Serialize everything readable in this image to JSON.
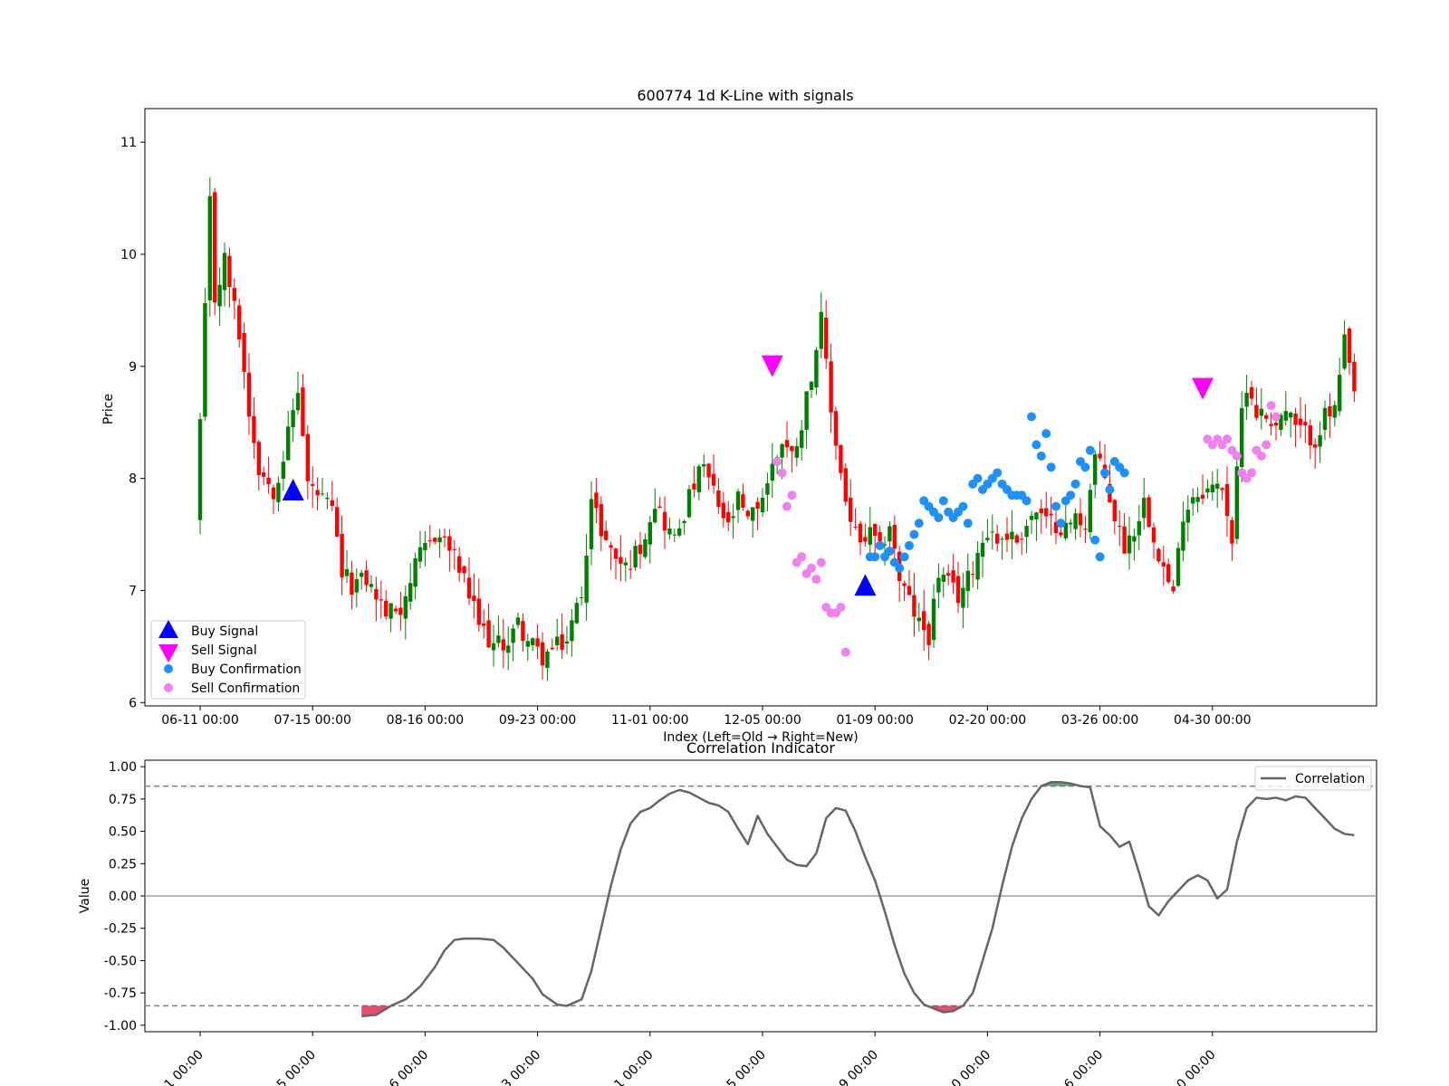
{
  "chart_data": [
    {
      "type": "candlestick",
      "title": "600774 1d K-Line with signals",
      "xlabel": "Index (Left=Old → Right=New)",
      "ylabel": "Price",
      "ylim": [
        5.97,
        11.3
      ],
      "yticks": [
        6,
        7,
        8,
        9,
        10,
        11
      ],
      "xticks": [
        {
          "index": 0,
          "label": "06-11 00:00"
        },
        {
          "index": 23,
          "label": "07-15 00:00"
        },
        {
          "index": 46,
          "label": "08-16 00:00"
        },
        {
          "index": 69,
          "label": "09-23 00:00"
        },
        {
          "index": 92,
          "label": "11-01 00:00"
        },
        {
          "index": 115,
          "label": "12-05 00:00"
        },
        {
          "index": 138,
          "label": "01-09 00:00"
        },
        {
          "index": 161,
          "label": "02-20 00:00"
        },
        {
          "index": 184,
          "label": "03-26 00:00"
        },
        {
          "index": 207,
          "label": "04-30 00:00"
        }
      ],
      "up_color": "#008000",
      "down_color": "#ff0000",
      "close_path": [
        [
          0,
          8.5
        ],
        [
          2,
          10.45
        ],
        [
          3,
          9.6
        ],
        [
          5,
          9.95
        ],
        [
          8,
          9.3
        ],
        [
          10,
          8.6
        ],
        [
          12,
          8.1
        ],
        [
          15,
          7.9
        ],
        [
          17,
          8.2
        ],
        [
          20,
          8.8
        ],
        [
          22,
          7.95
        ],
        [
          25,
          7.8
        ],
        [
          27,
          7.7
        ],
        [
          29,
          7.15
        ],
        [
          31,
          7.05
        ],
        [
          34,
          7.1
        ],
        [
          36,
          6.95
        ],
        [
          38,
          6.8
        ],
        [
          41,
          6.85
        ],
        [
          43,
          7.1
        ],
        [
          45,
          7.3
        ],
        [
          48,
          7.5
        ],
        [
          50,
          7.45
        ],
        [
          53,
          7.2
        ],
        [
          55,
          6.95
        ],
        [
          57,
          6.7
        ],
        [
          60,
          6.5
        ],
        [
          63,
          6.55
        ],
        [
          65,
          6.7
        ],
        [
          67,
          6.55
        ],
        [
          70,
          6.4
        ],
        [
          73,
          6.5
        ],
        [
          75,
          6.55
        ],
        [
          78,
          7.0
        ],
        [
          80,
          7.8
        ],
        [
          82,
          7.55
        ],
        [
          84,
          7.35
        ],
        [
          87,
          7.2
        ],
        [
          90,
          7.4
        ],
        [
          93,
          7.8
        ],
        [
          95,
          7.6
        ],
        [
          97,
          7.45
        ],
        [
          99,
          7.7
        ],
        [
          101,
          7.95
        ],
        [
          103,
          8.1
        ],
        [
          106,
          7.75
        ],
        [
          108,
          7.55
        ],
        [
          110,
          7.8
        ],
        [
          112,
          7.6
        ],
        [
          115,
          7.85
        ],
        [
          117,
          8.1
        ],
        [
          119,
          8.35
        ],
        [
          121,
          8.2
        ],
        [
          123,
          8.5
        ],
        [
          125,
          8.95
        ],
        [
          127,
          9.4
        ],
        [
          129,
          8.6
        ],
        [
          131,
          8.05
        ],
        [
          133,
          7.6
        ],
        [
          135,
          7.4
        ],
        [
          137,
          7.5
        ],
        [
          139,
          7.35
        ],
        [
          141,
          7.6
        ],
        [
          143,
          7.1
        ],
        [
          145,
          6.9
        ],
        [
          147,
          6.7
        ],
        [
          149,
          6.6
        ],
        [
          151,
          7.15
        ],
        [
          153,
          7.05
        ],
        [
          155,
          6.95
        ],
        [
          157,
          7.1
        ],
        [
          159,
          7.35
        ],
        [
          161,
          7.55
        ],
        [
          163,
          7.45
        ],
        [
          165,
          7.5
        ],
        [
          167,
          7.45
        ],
        [
          169,
          7.6
        ],
        [
          171,
          7.7
        ],
        [
          173,
          7.6
        ],
        [
          175,
          7.6
        ],
        [
          177,
          7.55
        ],
        [
          179,
          7.65
        ],
        [
          181,
          7.6
        ],
        [
          183,
          8.2
        ],
        [
          185,
          8.0
        ],
        [
          187,
          7.65
        ],
        [
          189,
          7.4
        ],
        [
          191,
          7.55
        ],
        [
          193,
          7.8
        ],
        [
          195,
          7.5
        ],
        [
          197,
          7.2
        ],
        [
          199,
          6.95
        ],
        [
          201,
          7.7
        ],
        [
          203,
          7.85
        ],
        [
          205,
          7.9
        ],
        [
          207,
          7.9
        ],
        [
          209,
          7.95
        ],
        [
          211,
          7.45
        ],
        [
          213,
          8.6
        ],
        [
          214,
          8.85
        ],
        [
          216,
          8.6
        ],
        [
          218,
          8.55
        ],
        [
          220,
          8.5
        ],
        [
          222,
          8.6
        ],
        [
          224,
          8.45
        ],
        [
          226,
          8.4
        ],
        [
          228,
          8.35
        ],
        [
          230,
          8.55
        ],
        [
          232,
          8.6
        ],
        [
          234,
          9.2
        ],
        [
          236,
          8.75
        ]
      ],
      "buy_signals": [
        {
          "x": 19,
          "y": 7.9
        },
        {
          "x": 136,
          "y": 7.05
        }
      ],
      "sell_signals": [
        {
          "x": 117,
          "y": 9.0
        },
        {
          "x": 205,
          "y": 8.8
        }
      ],
      "buy_confirmations": [
        [
          137,
          7.3
        ],
        [
          138,
          7.3
        ],
        [
          139,
          7.4
        ],
        [
          140,
          7.3
        ],
        [
          141,
          7.35
        ],
        [
          142,
          7.25
        ],
        [
          143,
          7.2
        ],
        [
          144,
          7.3
        ],
        [
          145,
          7.4
        ],
        [
          146,
          7.5
        ],
        [
          147,
          7.6
        ],
        [
          148,
          7.8
        ],
        [
          149,
          7.75
        ],
        [
          150,
          7.7
        ],
        [
          151,
          7.65
        ],
        [
          152,
          7.8
        ],
        [
          153,
          7.7
        ],
        [
          154,
          7.65
        ],
        [
          155,
          7.7
        ],
        [
          156,
          7.75
        ],
        [
          157,
          7.6
        ],
        [
          158,
          7.95
        ],
        [
          159,
          8.0
        ],
        [
          160,
          7.9
        ],
        [
          161,
          7.95
        ],
        [
          162,
          8.0
        ],
        [
          163,
          8.05
        ],
        [
          164,
          7.95
        ],
        [
          165,
          7.9
        ],
        [
          166,
          7.85
        ],
        [
          167,
          7.85
        ],
        [
          168,
          7.85
        ],
        [
          169,
          7.8
        ],
        [
          170,
          8.55
        ],
        [
          171,
          8.3
        ],
        [
          172,
          8.2
        ],
        [
          173,
          8.4
        ],
        [
          174,
          8.1
        ],
        [
          175,
          7.75
        ],
        [
          176,
          7.6
        ],
        [
          177,
          7.8
        ],
        [
          178,
          7.85
        ],
        [
          179,
          7.95
        ],
        [
          180,
          8.15
        ],
        [
          181,
          8.1
        ],
        [
          182,
          8.25
        ],
        [
          183,
          7.45
        ],
        [
          184,
          7.3
        ],
        [
          185,
          8.05
        ],
        [
          186,
          7.9
        ],
        [
          187,
          8.15
        ],
        [
          188,
          8.1
        ],
        [
          189,
          8.05
        ]
      ],
      "sell_confirmations": [
        [
          118,
          8.15
        ],
        [
          119,
          8.05
        ],
        [
          120,
          7.75
        ],
        [
          121,
          7.85
        ],
        [
          122,
          7.25
        ],
        [
          123,
          7.3
        ],
        [
          124,
          7.15
        ],
        [
          125,
          7.2
        ],
        [
          126,
          7.1
        ],
        [
          127,
          7.25
        ],
        [
          128,
          6.85
        ],
        [
          129,
          6.8
        ],
        [
          130,
          6.8
        ],
        [
          131,
          6.85
        ],
        [
          132,
          6.45
        ],
        [
          206,
          8.35
        ],
        [
          207,
          8.3
        ],
        [
          208,
          8.35
        ],
        [
          209,
          8.3
        ],
        [
          210,
          8.35
        ],
        [
          211,
          8.25
        ],
        [
          212,
          8.2
        ],
        [
          213,
          8.05
        ],
        [
          214,
          8.0
        ],
        [
          215,
          8.05
        ],
        [
          216,
          8.25
        ],
        [
          217,
          8.2
        ],
        [
          218,
          8.3
        ],
        [
          219,
          8.65
        ],
        [
          220,
          8.55
        ]
      ],
      "legend": [
        "Buy Signal",
        "Sell Signal",
        "Buy Confirmation",
        "Sell Confirmation"
      ],
      "legend_placement": "lower-left",
      "signal_colors": {
        "buy": "#0000ff",
        "sell": "#ff00ff",
        "buy_confirmation": "#1e90ff",
        "sell_confirmation": "#ee82ee"
      }
    },
    {
      "type": "line",
      "title": "Correlation Indicator",
      "ylabel": "Value",
      "ylim": [
        -1.05,
        1.05
      ],
      "yticks": [
        "1.00",
        "0.75",
        "0.50",
        "0.25",
        "0.00",
        "-0.25",
        "-0.50",
        "-0.75",
        "-1.00"
      ],
      "xtick_labels": [
        "1 00:00",
        "5 00:00",
        "6 00:00",
        "3 00:00",
        "1 00:00",
        "5 00:00",
        "9 00:00",
        "0 00:00",
        "6 00:00",
        "0 00:00"
      ],
      "series": [
        {
          "name": "Correlation",
          "color": "#666666",
          "points": [
            [
              33,
              -0.93
            ],
            [
              36,
              -0.92
            ],
            [
              39,
              -0.85
            ],
            [
              42,
              -0.8
            ],
            [
              45,
              -0.7
            ],
            [
              48,
              -0.55
            ],
            [
              50,
              -0.42
            ],
            [
              52,
              -0.34
            ],
            [
              54,
              -0.33
            ],
            [
              57,
              -0.33
            ],
            [
              60,
              -0.34
            ],
            [
              62,
              -0.4
            ],
            [
              65,
              -0.52
            ],
            [
              68,
              -0.64
            ],
            [
              70,
              -0.76
            ],
            [
              73,
              -0.84
            ],
            [
              75,
              -0.85
            ],
            [
              78,
              -0.8
            ],
            [
              80,
              -0.58
            ],
            [
              82,
              -0.25
            ],
            [
              84,
              0.08
            ],
            [
              86,
              0.36
            ],
            [
              88,
              0.56
            ],
            [
              90,
              0.65
            ],
            [
              92,
              0.68
            ],
            [
              94,
              0.74
            ],
            [
              96,
              0.79
            ],
            [
              98,
              0.82
            ],
            [
              100,
              0.8
            ],
            [
              102,
              0.76
            ],
            [
              104,
              0.72
            ],
            [
              106,
              0.7
            ],
            [
              108,
              0.65
            ],
            [
              110,
              0.52
            ],
            [
              112,
              0.4
            ],
            [
              114,
              0.62
            ],
            [
              116,
              0.48
            ],
            [
              118,
              0.38
            ],
            [
              120,
              0.28
            ],
            [
              122,
              0.24
            ],
            [
              124,
              0.23
            ],
            [
              126,
              0.33
            ],
            [
              128,
              0.6
            ],
            [
              130,
              0.68
            ],
            [
              132,
              0.66
            ],
            [
              134,
              0.5
            ],
            [
              136,
              0.3
            ],
            [
              138,
              0.12
            ],
            [
              140,
              -0.12
            ],
            [
              142,
              -0.38
            ],
            [
              144,
              -0.6
            ],
            [
              146,
              -0.75
            ],
            [
              148,
              -0.84
            ],
            [
              150,
              -0.87
            ],
            [
              152,
              -0.9
            ],
            [
              154,
              -0.89
            ],
            [
              156,
              -0.85
            ],
            [
              158,
              -0.75
            ],
            [
              160,
              -0.5
            ],
            [
              162,
              -0.25
            ],
            [
              164,
              0.08
            ],
            [
              166,
              0.38
            ],
            [
              168,
              0.6
            ],
            [
              170,
              0.75
            ],
            [
              172,
              0.85
            ],
            [
              174,
              0.88
            ],
            [
              176,
              0.88
            ],
            [
              178,
              0.87
            ],
            [
              180,
              0.85
            ],
            [
              182,
              0.84
            ],
            [
              184,
              0.54
            ],
            [
              186,
              0.47
            ],
            [
              188,
              0.38
            ],
            [
              190,
              0.42
            ],
            [
              192,
              0.18
            ],
            [
              194,
              -0.08
            ],
            [
              196,
              -0.15
            ],
            [
              198,
              -0.04
            ],
            [
              200,
              0.04
            ],
            [
              202,
              0.12
            ],
            [
              204,
              0.16
            ],
            [
              206,
              0.12
            ],
            [
              208,
              -0.02
            ],
            [
              210,
              0.05
            ],
            [
              212,
              0.42
            ],
            [
              214,
              0.68
            ],
            [
              216,
              0.76
            ],
            [
              218,
              0.75
            ],
            [
              220,
              0.76
            ],
            [
              222,
              0.74
            ],
            [
              224,
              0.77
            ],
            [
              226,
              0.76
            ],
            [
              228,
              0.68
            ],
            [
              230,
              0.6
            ],
            [
              232,
              0.52
            ],
            [
              234,
              0.48
            ],
            [
              236,
              0.47
            ]
          ]
        }
      ],
      "thresholds": [
        0.85,
        -0.85
      ],
      "zero_line": 0.0,
      "fill_above_color": "#2e8b57",
      "fill_below_color": "#dc143c",
      "legend_placement": "top-right"
    }
  ]
}
